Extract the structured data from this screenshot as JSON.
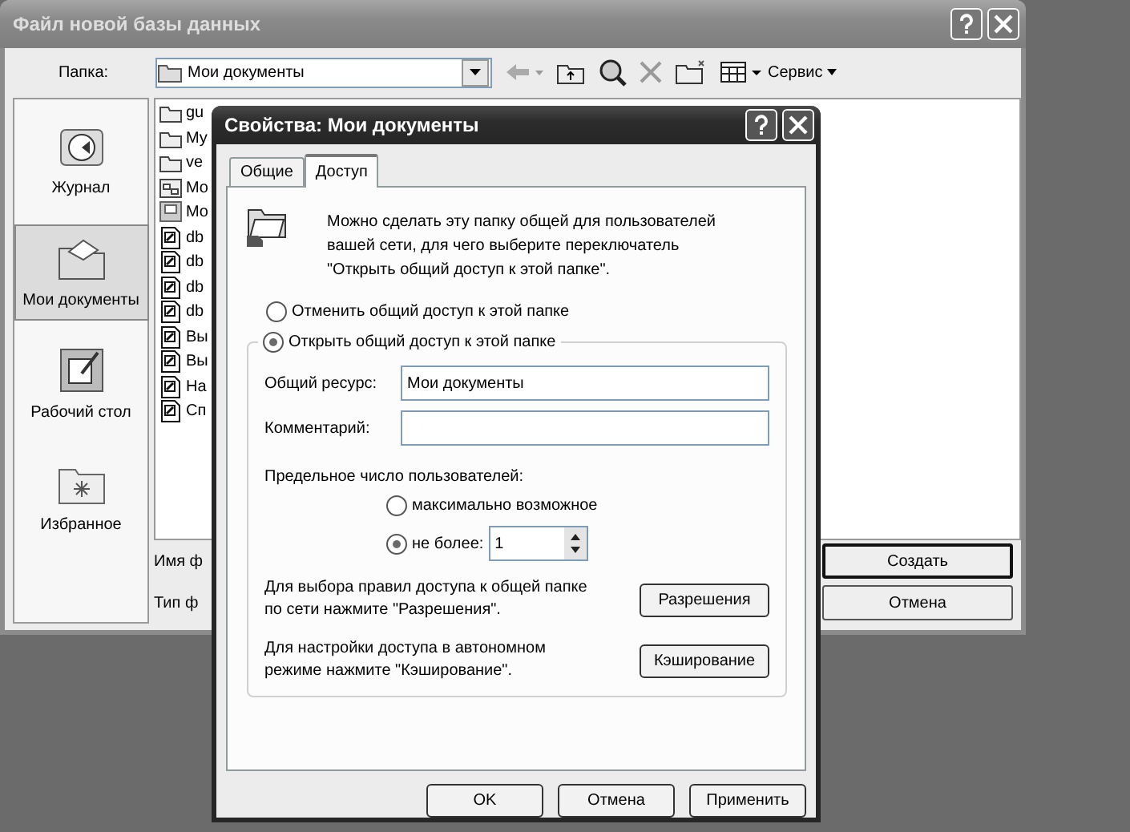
{
  "back_window": {
    "title": "Файл новой базы данных",
    "folder_label": "Папка:",
    "folder": "Мои документы",
    "tools_menu": "Сервис",
    "places": [
      {
        "label": "Журнал",
        "kind": "history",
        "selected": false
      },
      {
        "label": "Мои документы",
        "kind": "documents",
        "selected": true
      },
      {
        "label": "Рабочий стол",
        "kind": "desktop",
        "selected": false
      },
      {
        "label": "Избранное",
        "kind": "favorites",
        "selected": false
      }
    ],
    "files": [
      {
        "name": "gu",
        "kind": "folder"
      },
      {
        "name": "My",
        "kind": "folder"
      },
      {
        "name": "ve",
        "kind": "folder"
      },
      {
        "name": "Mo",
        "kind": "network"
      },
      {
        "name": "Mo",
        "kind": "briefcase"
      },
      {
        "name": "db",
        "kind": "database"
      },
      {
        "name": "db",
        "kind": "database"
      },
      {
        "name": "db",
        "kind": "database"
      },
      {
        "name": "db",
        "kind": "database"
      },
      {
        "name": "Вы",
        "kind": "database"
      },
      {
        "name": "Вы",
        "kind": "database"
      },
      {
        "name": "На",
        "kind": "database"
      },
      {
        "name": "Сп",
        "kind": "database"
      }
    ],
    "file_name_label": "Имя ф",
    "file_type_label": "Тип ф",
    "buttons": [
      {
        "label": "Создать",
        "default": true
      },
      {
        "label": "Отмена",
        "default": false
      }
    ]
  },
  "dialog": {
    "title": "Свойства: Мои документы",
    "tabs": [
      {
        "label": "Общие",
        "selected": false
      },
      {
        "label": "Доступ",
        "selected": true
      }
    ],
    "description": "Можно сделать эту папку общей для пользователей\nвашей сети, для чего выберите переключатель\n\"Открыть общий доступ к этой папке\".",
    "sharing_options": [
      {
        "label": "Отменить общий доступ к этой папке",
        "selected": false
      },
      {
        "label": "Открыть общий доступ к этой папке",
        "selected": true
      }
    ],
    "share_name_label": "Общий ресурс:",
    "share_name": "Мои документы",
    "comment_label": "Комментарий:",
    "user_limit_label": "Предельное число пользователей:",
    "user_limit_options": [
      {
        "label": "максимально возможное",
        "selected": false
      },
      {
        "label": "не более:",
        "selected": true
      }
    ],
    "user_limit_value": "1",
    "permissions_text": "Для выбора правил доступа к общей папке\nпо сети нажмите \"Разрешения\".",
    "permissions_button": "Разрешения",
    "caching_text": "Для настройки доступа в автономном\nрежиме нажмите \"Кэширование\".",
    "caching_button": "Кэширование",
    "buttons": [
      "OK",
      "Отмена",
      "Применить"
    ]
  }
}
